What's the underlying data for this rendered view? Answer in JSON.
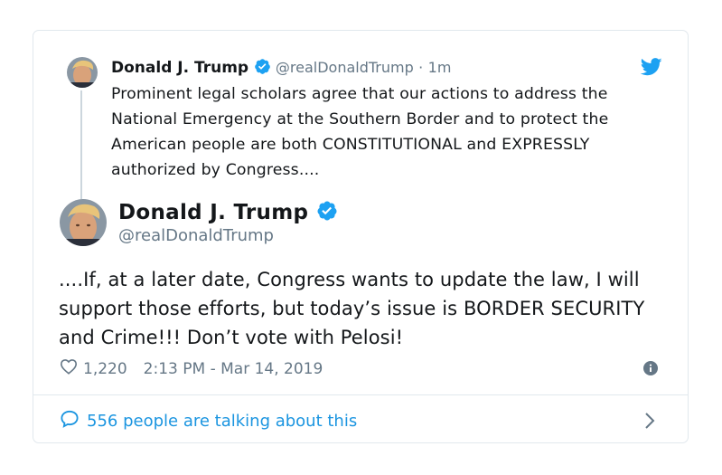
{
  "parent_tweet": {
    "name": "Donald J. Trump",
    "handle": "@realDonaldTrump",
    "separator": "·",
    "time_ago": "1m",
    "text": "Prominent legal scholars agree that our actions to address the National Emergency at the Southern Border and to protect the American people are both CONSTITUTIONAL and EXPRESSLY authorized by Congress...."
  },
  "main_tweet": {
    "name": "Donald J. Trump",
    "handle": "@realDonaldTrump",
    "text": "....If, at a later date, Congress wants to update the law, I will support those efforts, but today’s issue is BORDER SECURITY and Crime!!! Don’t vote with Pelosi!",
    "likes": "1,220",
    "timestamp": "2:13 PM - Mar 14, 2019"
  },
  "footer": {
    "talking_label": "556 people are talking about this"
  },
  "colors": {
    "twitter_blue": "#1da1f2",
    "link_blue": "#1b95e0",
    "text_gray": "#657786",
    "border": "#e1e8ed"
  },
  "icons": [
    "avatar",
    "verified-badge-icon",
    "twitter-bird-icon",
    "heart-icon",
    "info-icon",
    "speech-bubble-icon",
    "chevron-right-icon"
  ]
}
